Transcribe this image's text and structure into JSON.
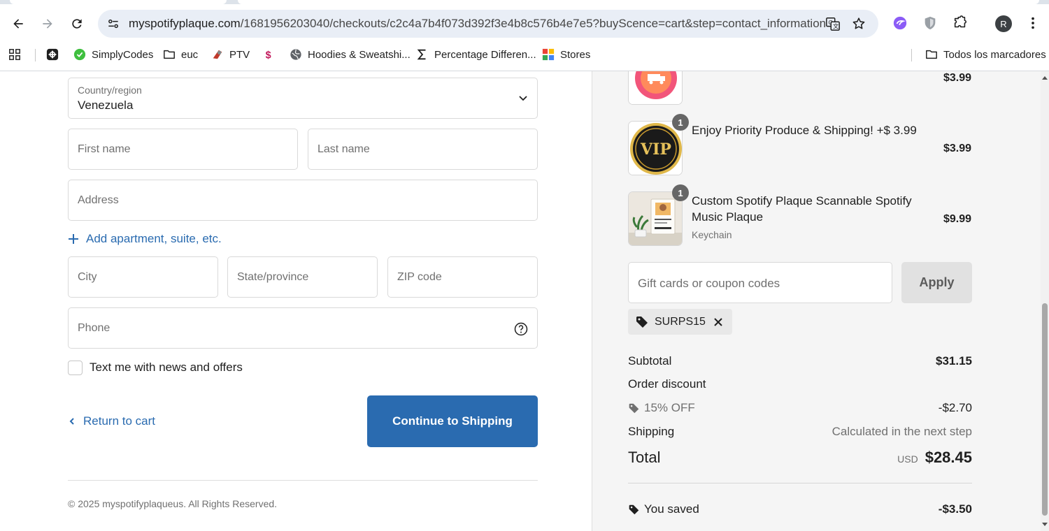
{
  "browser": {
    "url_host": "myspotifyplaque.com",
    "url_path": "/1681956203040/checkouts/c2c4a7b4f073d392f3e4b8c576b4e7e5?buyScence=cart&step=contact_information",
    "profile_initial": "R",
    "bookmarks": [
      {
        "label": "SimplyCodes",
        "icon": "simplycodes-icon"
      },
      {
        "label": "euc",
        "icon": "folder-icon"
      },
      {
        "label": "PTV",
        "icon": "ptv-icon"
      },
      {
        "label": "",
        "icon": "dollar-icon"
      },
      {
        "label": "Hoodies & Sweatshi...",
        "icon": "globe-icon"
      },
      {
        "label": "Percentage Differen...",
        "icon": "sigma-icon"
      },
      {
        "label": "Stores",
        "icon": "stores-icon"
      }
    ],
    "all_bookmarks": "Todos los marcadores"
  },
  "form": {
    "country_label": "Country/region",
    "country_value": "Venezuela",
    "first_name_ph": "First name",
    "last_name_ph": "Last name",
    "address_ph": "Address",
    "add_apartment": "Add apartment, suite, etc.",
    "city_ph": "City",
    "state_ph": "State/province",
    "zip_ph": "ZIP code",
    "phone_ph": "Phone",
    "text_me": "Text me with news and offers",
    "return_to_cart": "Return to cart",
    "continue": "Continue to Shipping",
    "footer": "© 2025 myspotifyplaqueus. All Rights Reserved."
  },
  "summary": {
    "items": [
      {
        "title": "",
        "subtitle": "",
        "price": "$3.99",
        "qty": ""
      },
      {
        "title": "Enjoy Priority Produce & Shipping! +$ 3.99",
        "subtitle": "",
        "price": "$3.99",
        "qty": "1"
      },
      {
        "title": "Custom Spotify Plaque Scannable Spotify Music Plaque",
        "subtitle": "Keychain",
        "price": "$9.99",
        "qty": "1"
      }
    ],
    "vip_text": "VIP",
    "coupon_ph": "Gift cards or coupon codes",
    "apply": "Apply",
    "applied_code": "SURPS15",
    "subtotal_label": "Subtotal",
    "subtotal": "$31.15",
    "order_discount_label": "Order discount",
    "discount_name": "15% OFF",
    "discount_value": "-$2.70",
    "shipping_label": "Shipping",
    "shipping_value": "Calculated in the next step",
    "total_label": "Total",
    "currency": "USD",
    "total": "$28.45",
    "saved_label": "You saved",
    "saved": "-$3.50"
  },
  "colors": {
    "accent": "#2a6bb0",
    "panel_bg": "#f5f5f5"
  }
}
